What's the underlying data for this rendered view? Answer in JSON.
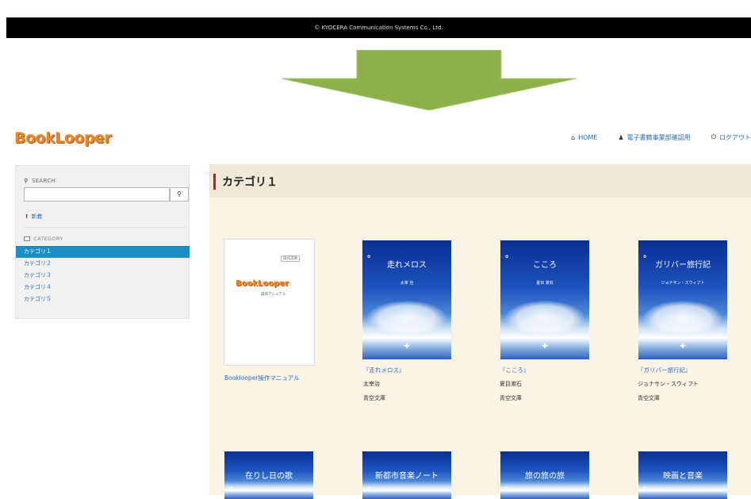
{
  "footer": {
    "copyright": "© KYOCERA Communication Systems Co., Ltd."
  },
  "brand": {
    "logo_text": "BookLooper"
  },
  "topnav": [
    {
      "label": "HOME",
      "icon": "home-icon",
      "glyph": "⌂"
    },
    {
      "label": "電子書籍事業部確認用",
      "icon": "user-icon",
      "glyph": "♟"
    },
    {
      "label": "ログアウト",
      "icon": "power-icon",
      "glyph": "⏻"
    }
  ],
  "sidebar": {
    "search_label": "SEARCH",
    "search_placeholder": "",
    "search_button": "🔍",
    "new_label": "新着",
    "category_label": "CATEGORY",
    "categories": [
      "カテゴリ１",
      "カテゴリ２",
      "カテゴリ３",
      "カテゴリ４",
      "カテゴリ５"
    ]
  },
  "main": {
    "heading": "カテゴリ１",
    "books": [
      {
        "title": "Booklooper操作マニュアル",
        "author": "",
        "publisher": "",
        "cover_title": "",
        "cover_author": "",
        "manual_tag": "操作説明",
        "manual_logo": "BookLooper",
        "manual_sub": "操作マニュアル"
      },
      {
        "title": "『走れメロス』",
        "author": "太宰治",
        "publisher": "青空文庫",
        "cover_title": "走れメロス",
        "cover_author": "太宰 治"
      },
      {
        "title": "『こころ』",
        "author": "夏目漱石",
        "publisher": "青空文庫",
        "cover_title": "こころ",
        "cover_author": "夏目 漱石"
      },
      {
        "title": "『ガリバー旅行記』",
        "author": "ジョナサン・スウィフト",
        "publisher": "青空文庫",
        "cover_title": "ガリバー旅行記",
        "cover_author": "ジョナサン・スウィフト"
      }
    ],
    "row2_covers": [
      "在りし日の歌",
      "新都市音楽ノート",
      "旅の旅の旅",
      "映画と音楽"
    ]
  }
}
